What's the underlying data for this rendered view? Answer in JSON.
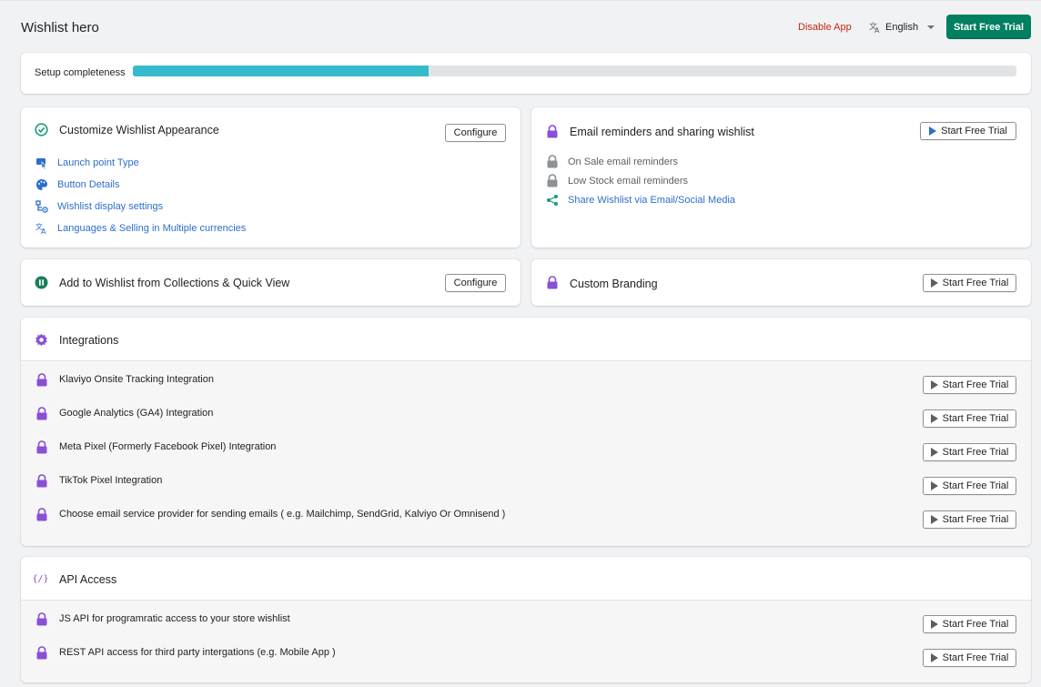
{
  "header": {
    "title": "Wishlist hero",
    "disable_app": "Disable App",
    "language": "English",
    "start_trial": "Start Free Trial"
  },
  "setup": {
    "label": "Setup completeness",
    "progress_percent": 33.5
  },
  "customize": {
    "title": "Customize Wishlist Appearance",
    "button": "Configure",
    "links": [
      {
        "label": "Launch point Type",
        "icon": "cursor-click-icon"
      },
      {
        "label": "Button Details",
        "icon": "palette-icon"
      },
      {
        "label": "Wishlist display settings",
        "icon": "settings-tree-icon"
      },
      {
        "label": "Languages & Selling in Multiple currencies",
        "icon": "translate-icon"
      }
    ]
  },
  "email": {
    "title": "Email reminders and sharing wishlist",
    "button": "Start Free Trial",
    "items": [
      {
        "label": "On Sale email reminders",
        "icon": "lock-icon"
      },
      {
        "label": "Low Stock email reminders",
        "icon": "lock-icon"
      },
      {
        "label": "Share Wishlist via Email/Social Media",
        "icon": "share-icon"
      }
    ]
  },
  "collections": {
    "title": "Add to Wishlist from Collections & Quick View",
    "button": "Configure"
  },
  "branding": {
    "title": "Custom Branding",
    "button": "Start Free Trial"
  },
  "integrations": {
    "title": "Integrations",
    "button": "Start Free Trial",
    "items": [
      "Klaviyo Onsite Tracking Integration",
      "Google Analytics (GA4) Integration",
      "Meta Pixel (Formerly Facebook Pixel) Integration",
      "TikTok Pixel Integration",
      "Choose email service provider for sending emails ( e.g. Mailchimp, SendGrid, Kalviyo Or Omnisend )"
    ]
  },
  "api": {
    "title": "API Access",
    "button": "Start Free Trial",
    "items": [
      "JS API for programratic access to your store wishlist",
      "REST API access for third party intergations (e.g. Mobile App )"
    ]
  },
  "colors": {
    "primary": "#008060",
    "progress": "#36bbcc",
    "link": "#2c6ecb",
    "lock": "#8a4fd6",
    "danger": "#c4290f",
    "success": "#1a9b7b"
  }
}
